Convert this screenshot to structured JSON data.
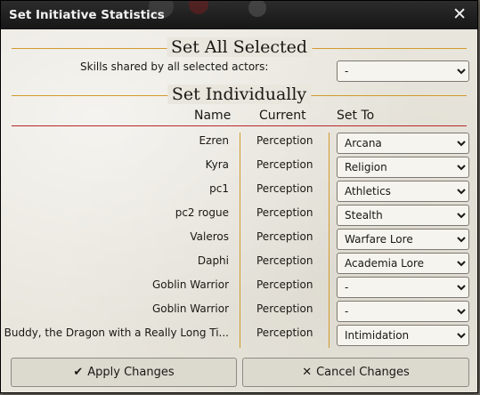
{
  "window": {
    "title": "Set Initiative Statistics",
    "close_glyph": "✕"
  },
  "all_selected": {
    "heading": "Set All Selected",
    "shared_label": "Skills shared by all selected actors:",
    "shared_value": "-"
  },
  "individual": {
    "heading": "Set Individually",
    "col_name": "Name",
    "col_current": "Current",
    "col_set_to": "Set To"
  },
  "rows": [
    {
      "name": "Ezren",
      "current": "Perception",
      "set_to": "Arcana"
    },
    {
      "name": "Kyra",
      "current": "Perception",
      "set_to": "Religion"
    },
    {
      "name": "pc1",
      "current": "Perception",
      "set_to": "Athletics"
    },
    {
      "name": "pc2 rogue",
      "current": "Perception",
      "set_to": "Stealth"
    },
    {
      "name": "Valeros",
      "current": "Perception",
      "set_to": "Warfare Lore"
    },
    {
      "name": "Daphi",
      "current": "Perception",
      "set_to": "Academia Lore"
    },
    {
      "name": "Goblin Warrior",
      "current": "Perception",
      "set_to": "-"
    },
    {
      "name": "Goblin Warrior",
      "current": "Perception",
      "set_to": "-"
    },
    {
      "name": "Buddy, the Dragon with a Really Long Ti...",
      "current": "Perception",
      "set_to": "Intimidation"
    }
  ],
  "buttons": {
    "apply_label": "Apply Changes",
    "apply_icon": "checkmark-icon",
    "cancel_label": "Cancel Changes",
    "cancel_icon": "close-icon"
  },
  "colors": {
    "accent_rule": "#d29a2c",
    "header_rule": "#b9272a",
    "titlebar": "#1e1e1e"
  }
}
